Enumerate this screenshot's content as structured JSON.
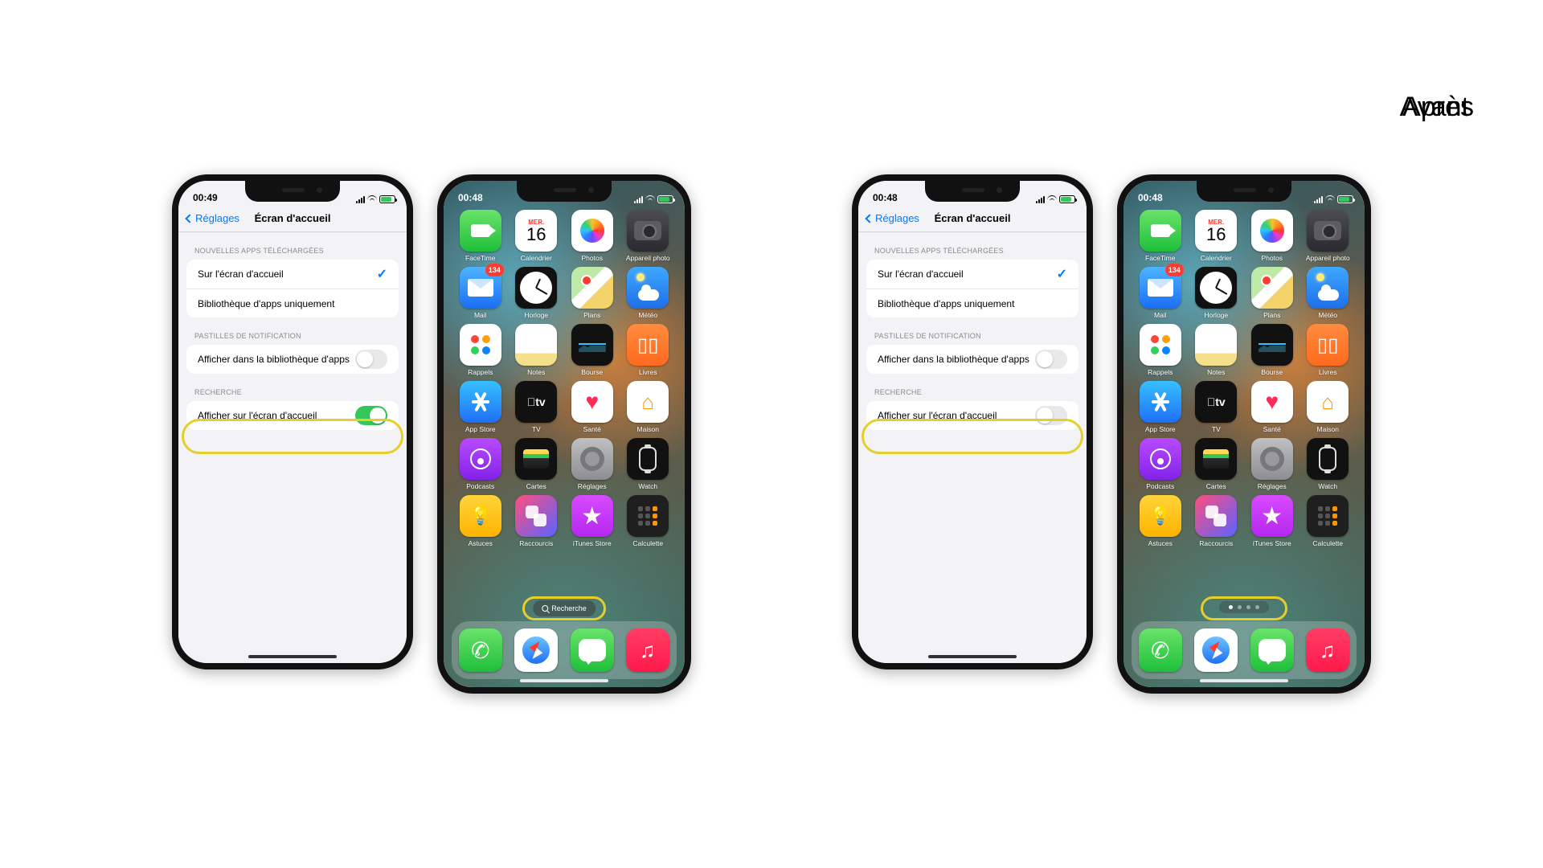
{
  "labels": {
    "before": "Avant",
    "after": "Après"
  },
  "settings": {
    "back_label": "Réglages",
    "title": "Écran d'accueil",
    "sections": {
      "downloaded_header": "NOUVELLES APPS TÉLÉCHARGÉES",
      "opt_home": "Sur l'écran d'accueil",
      "opt_library": "Bibliothèque d'apps uniquement",
      "badges_header": "PASTILLES DE NOTIFICATION",
      "badges_row": "Afficher dans la bibliothèque d'apps",
      "search_header": "RECHERCHE",
      "search_row": "Afficher sur l'écran d'accueil"
    },
    "before": {
      "time": "00:49",
      "search_toggle_on": true
    },
    "after": {
      "time": "00:48",
      "search_toggle_on": false
    }
  },
  "home": {
    "time": "00:48",
    "search_pill_label": "Recherche",
    "calendar": {
      "dow": "MER.",
      "day": "16"
    },
    "apps": [
      {
        "name": "FaceTime",
        "icon": "facetime"
      },
      {
        "name": "Calendrier",
        "icon": "calendar"
      },
      {
        "name": "Photos",
        "icon": "photos"
      },
      {
        "name": "Appareil photo",
        "icon": "camera"
      },
      {
        "name": "Mail",
        "icon": "mail",
        "badge": "134"
      },
      {
        "name": "Horloge",
        "icon": "clock"
      },
      {
        "name": "Plans",
        "icon": "maps"
      },
      {
        "name": "Météo",
        "icon": "weather"
      },
      {
        "name": "Rappels",
        "icon": "reminders"
      },
      {
        "name": "Notes",
        "icon": "notes"
      },
      {
        "name": "Bourse",
        "icon": "stocks"
      },
      {
        "name": "Livres",
        "icon": "books"
      },
      {
        "name": "App Store",
        "icon": "appstore"
      },
      {
        "name": "TV",
        "icon": "tv"
      },
      {
        "name": "Santé",
        "icon": "health"
      },
      {
        "name": "Maison",
        "icon": "home"
      },
      {
        "name": "Podcasts",
        "icon": "podcasts"
      },
      {
        "name": "Cartes",
        "icon": "wallet"
      },
      {
        "name": "Réglages",
        "icon": "settings"
      },
      {
        "name": "Watch",
        "icon": "watch"
      },
      {
        "name": "Astuces",
        "icon": "tips"
      },
      {
        "name": "Raccourcis",
        "icon": "shortcuts"
      },
      {
        "name": "iTunes Store",
        "icon": "itunes"
      },
      {
        "name": "Calculette",
        "icon": "calc"
      }
    ],
    "dock": [
      {
        "name": "Téléphone",
        "icon": "phone"
      },
      {
        "name": "Safari",
        "icon": "safari"
      },
      {
        "name": "Messages",
        "icon": "messages"
      },
      {
        "name": "Musique",
        "icon": "music"
      }
    ],
    "page_count": 4,
    "active_page": 0
  }
}
